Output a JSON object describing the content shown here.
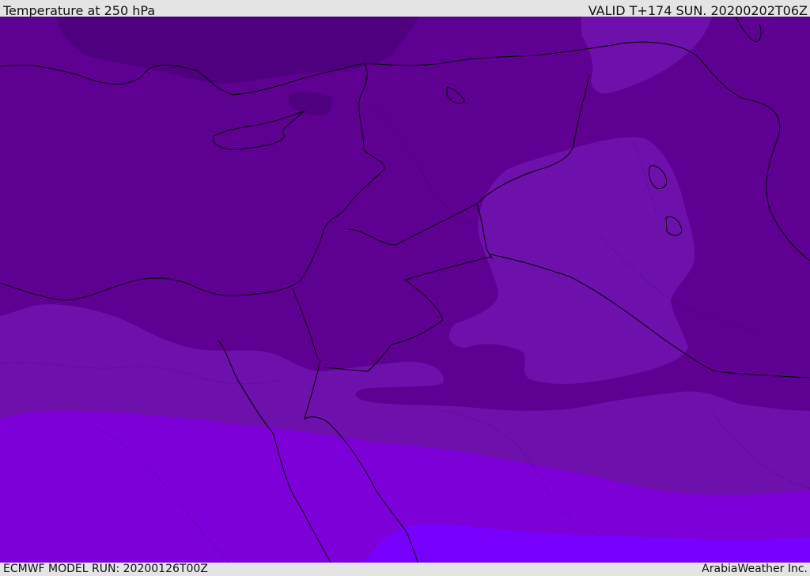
{
  "header": {
    "title": "Temperature at 250 hPa",
    "valid": "VALID T+174 SUN. 20200202T06Z"
  },
  "footer": {
    "model_run": "ECMWF MODEL RUN: 20200126T00Z",
    "credit": "ArabiaWeather Inc."
  },
  "colors": {
    "band_darkest": "#4f007f",
    "band_dark": "#5e0092",
    "band_mid": "#6e10ac",
    "band_light": "#7d00d9",
    "band_lightest": "#7800ff",
    "coastline": "#000000"
  }
}
